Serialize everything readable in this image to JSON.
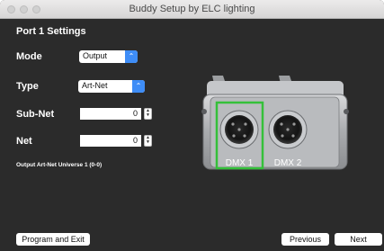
{
  "window": {
    "title": "Buddy Setup by ELC lighting"
  },
  "heading": "Port 1 Settings",
  "fields": {
    "mode": {
      "label": "Mode",
      "value": "Output"
    },
    "type": {
      "label": "Type",
      "value": "Art-Net"
    },
    "subnet": {
      "label": "Sub-Net",
      "value": "0"
    },
    "net": {
      "label": "Net",
      "value": "0"
    }
  },
  "info_text": "Output Art-Net Universe 1 (0-0)",
  "device": {
    "port1_label": "DMX 1",
    "port2_label": "DMX 2",
    "highlight_color": "#35c03a"
  },
  "buttons": {
    "program_exit": "Program and Exit",
    "previous": "Previous",
    "next": "Next"
  }
}
